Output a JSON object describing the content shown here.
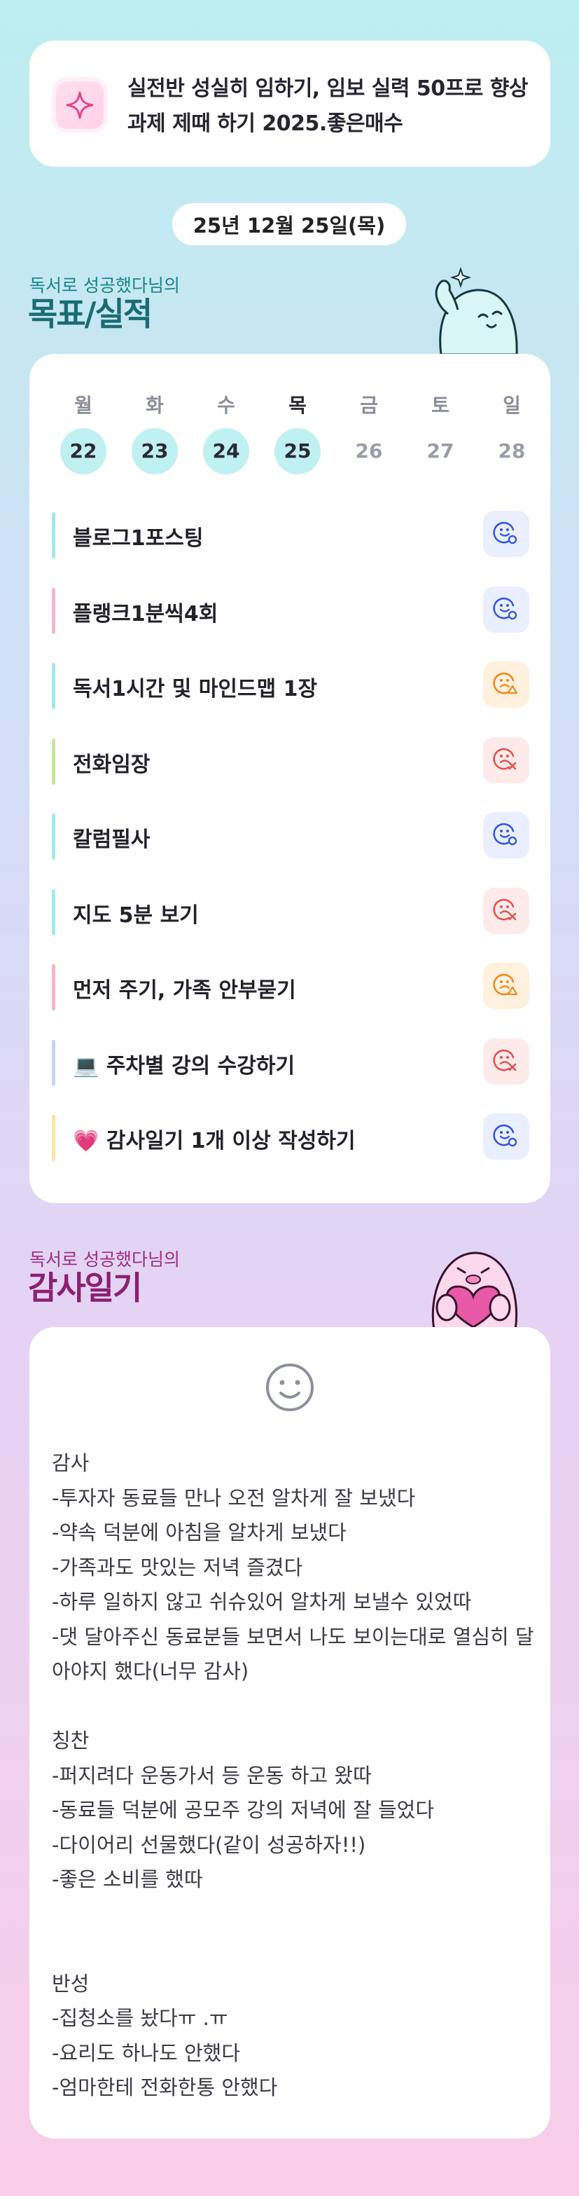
{
  "goal": {
    "text": "실전반 성실히 임하기, 임보 실력 50프로 향상 과제 제때 하기 2025.좋은매수",
    "icon": "sparkle-icon"
  },
  "date": "25년 12월 25일(목)",
  "goals_section": {
    "subtitle": "독서로 성공했다님의",
    "title": "목표/실적"
  },
  "week": {
    "days": [
      {
        "name": "월",
        "num": "22",
        "active": true
      },
      {
        "name": "화",
        "num": "23",
        "active": true
      },
      {
        "name": "수",
        "num": "24",
        "active": true
      },
      {
        "name": "목",
        "num": "25",
        "active": true,
        "today": true
      },
      {
        "name": "금",
        "num": "26",
        "active": false
      },
      {
        "name": "토",
        "num": "27",
        "active": false
      },
      {
        "name": "일",
        "num": "28",
        "active": false
      }
    ]
  },
  "tasks": [
    {
      "label": "블로그1포스팅",
      "bar_color": "#a6e7ea",
      "status": "done",
      "emo_color": "#3657e0"
    },
    {
      "label": "플랭크1분씩4회",
      "bar_color": "#f6b6d2",
      "status": "done",
      "emo_color": "#3657e0"
    },
    {
      "label": "독서1시간 및 마인드맵 1장",
      "bar_color": "#a6e7ea",
      "status": "partial",
      "emo_color": "#f08a1a"
    },
    {
      "label": "전화임장",
      "bar_color": "#c7e59a",
      "status": "fail",
      "emo_color": "#e0534f"
    },
    {
      "label": "칼럼필사",
      "bar_color": "#a6e7ea",
      "status": "done",
      "emo_color": "#3657e0"
    },
    {
      "label": "지도 5분 보기",
      "bar_color": "#a6e7ea",
      "status": "fail",
      "emo_color": "#e0534f"
    },
    {
      "label": "먼저 주기, 가족 안부묻기",
      "bar_color": "#f6b6c0",
      "status": "partial",
      "emo_color": "#f08a1a"
    },
    {
      "label": "💻 주차별 강의 수강하기",
      "bar_color": "#c9d2f3",
      "status": "fail",
      "emo_color": "#e0534f"
    },
    {
      "label": "💗 감사일기 1개 이상 작성하기",
      "bar_color": "#fbe2a8",
      "status": "done",
      "emo_color": "#3657e0"
    }
  ],
  "diary_section": {
    "subtitle": "독서로 성공했다님의",
    "title": "감사일기"
  },
  "diary": {
    "face_icon": "smiley-face-icon",
    "text": "감사\n-투자자 동료들 만나 오전 알차게 잘 보냈다\n-약속 덕분에 아침을 알차게 보냈다\n-가족과도 맛있는 저녁 즐겼다\n-하루 일하지 않고 쉬슈있어 알차게 보낼수 있었따\n-댓 달아주신 동료분들 보면서 나도 보이는대로 열심히 달아야지 했다(너무 감사)\n\n칭찬\n-퍼지려다 운동가서 등 운동 하고 왔따\n-동료들 덕분에 공모주 강의 저녁에 잘 들었다\n-다이어리 선물했다(같이 성공하자!!)\n-좋은 소비를 했따\n\n\n반성\n-집청소를 놨다ㅠ .ㅠ\n-요리도 하나도 안했다\n-엄마한테 전화한통 안했다"
  }
}
